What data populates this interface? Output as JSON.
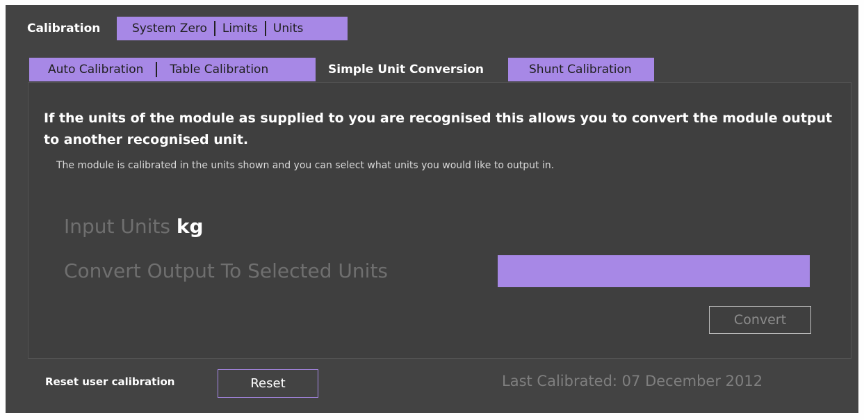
{
  "top_tabs": {
    "active": "Calibration",
    "inactive": [
      "System Zero",
      "Limits",
      "Units"
    ]
  },
  "sub_tabs": {
    "group_left": [
      "Auto Calibration",
      "Table Calibration"
    ],
    "active": "Simple Unit Conversion",
    "right": "Shunt Calibration"
  },
  "panel": {
    "headline": "If the units of the module as supplied to you are recognised this allows you to convert the module output to another recognised unit.",
    "description": "The module is calibrated in the units shown and you can select  what units you would like to output in.",
    "input_units_label": "Input Units",
    "input_units_value": "kg",
    "convert_label": "Convert Output To Selected Units",
    "selected_units": "",
    "convert_button": "Convert"
  },
  "footer": {
    "reset_label": "Reset user calibration",
    "reset_button": "Reset",
    "last_calibrated": "Last Calibrated: 07 December 2012"
  },
  "colors": {
    "accent": "#a788e6",
    "background": "#434343",
    "panel": "#3f3f3f"
  }
}
